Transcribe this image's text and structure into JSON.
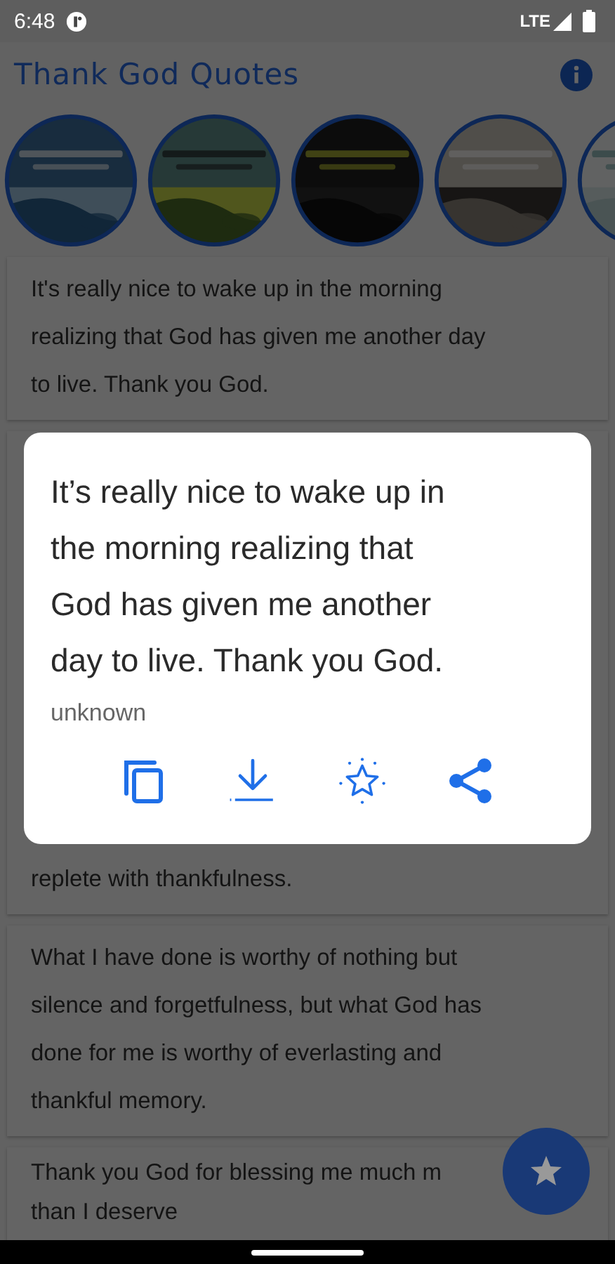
{
  "status_bar": {
    "time": "6:48",
    "network": "LTE"
  },
  "app_bar": {
    "title": "Thank God Quotes"
  },
  "quotes": [
    {
      "lines": [
        "It's really nice to wake up in the morning",
        "realizing that God has given me another day",
        "to live. Thank you God."
      ]
    },
    {
      "lines": [
        "replete with thankfulness."
      ],
      "kind": "covered"
    },
    {
      "lines": [
        "What I have done is worthy of nothing but",
        "silence and forgetfulness, but what God has",
        "done for me is worthy of everlasting and",
        "thankful memory."
      ]
    },
    {
      "lines": [
        "Thank you God for blessing me much m",
        "than I deserve"
      ],
      "kind": "cut"
    }
  ],
  "dialog": {
    "lines": [
      "It’s really nice to wake up in",
      "the morning realizing that",
      "God has given me another",
      "day to live. Thank you God."
    ],
    "author": "unknown",
    "actions": [
      {
        "kind": "copy"
      },
      {
        "kind": "download"
      },
      {
        "kind": "favorite"
      },
      {
        "kind": "share"
      }
    ]
  }
}
